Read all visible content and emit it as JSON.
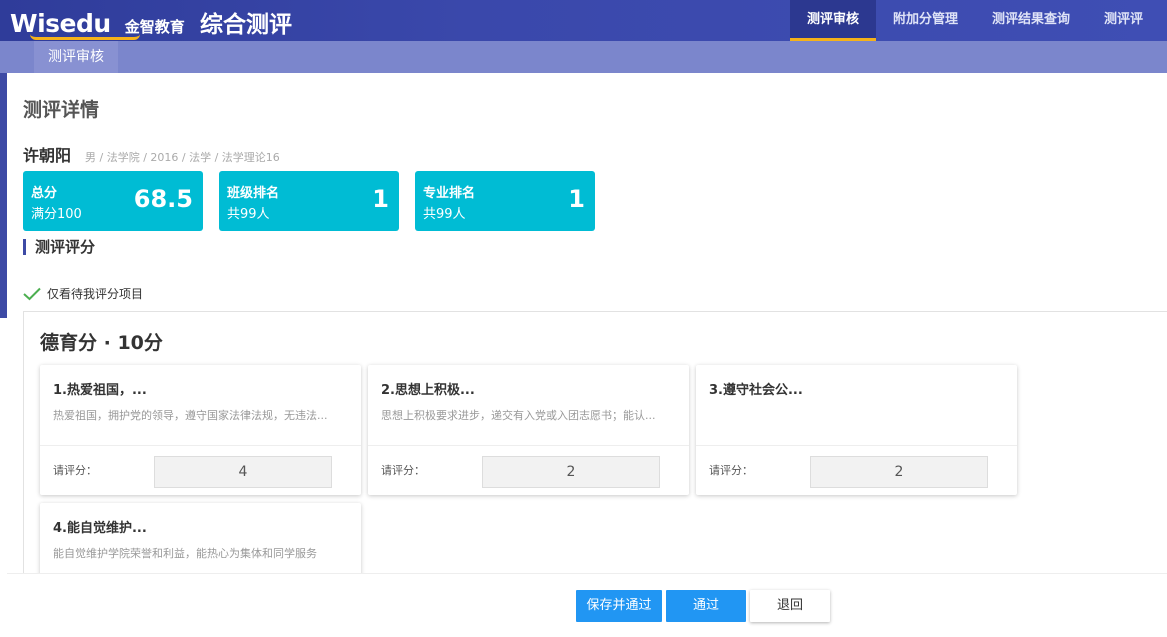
{
  "header": {
    "logo_text": "Wisedu",
    "logo_cn": "金智教育",
    "app_title": "综合测评",
    "nav": [
      {
        "label": "测评审核",
        "active": true
      },
      {
        "label": "附加分管理",
        "active": false
      },
      {
        "label": "测评结果查询",
        "active": false
      },
      {
        "label": "测评评",
        "active": false
      }
    ],
    "accent_color": "#f5b21a"
  },
  "breadcrumb": {
    "label": "测评审核"
  },
  "page": {
    "title": "测评详情"
  },
  "student": {
    "name": "许朝阳",
    "meta": "男 / 法学院 / 2016 / 法学 / 法学理论16"
  },
  "stats": [
    {
      "label": "总分",
      "sub": "满分100",
      "value": "68.5"
    },
    {
      "label": "班级排名",
      "sub": "共99人",
      "value": "1"
    },
    {
      "label": "专业排名",
      "sub": "共99人",
      "value": "1"
    }
  ],
  "section": {
    "title": "测评评分"
  },
  "filter": {
    "label": "仅看待我评分项目",
    "checked": true,
    "icon": "check-icon"
  },
  "panel": {
    "title": "德育分 · 10分",
    "items": [
      {
        "title": "1.热爱祖国，...",
        "desc": "热爱祖国，拥护党的领导，遵守国家法律法规，无违法...",
        "score_label": "请评分：",
        "score": "4"
      },
      {
        "title": "2.思想上积极...",
        "desc": "思想上积极要求进步，递交有入党或入团志愿书；能认...",
        "score_label": "请评分：",
        "score": "2"
      },
      {
        "title": "3.遵守社会公...",
        "desc": "",
        "score_label": "请评分：",
        "score": "2"
      },
      {
        "title": "4.能自觉维护...",
        "desc": "能自觉维护学院荣誉和利益，能热心为集体和同学服务",
        "score_label": "",
        "score": ""
      }
    ]
  },
  "footer": {
    "save_pass": "保存并通过",
    "pass": "通过",
    "reject": "退回"
  }
}
